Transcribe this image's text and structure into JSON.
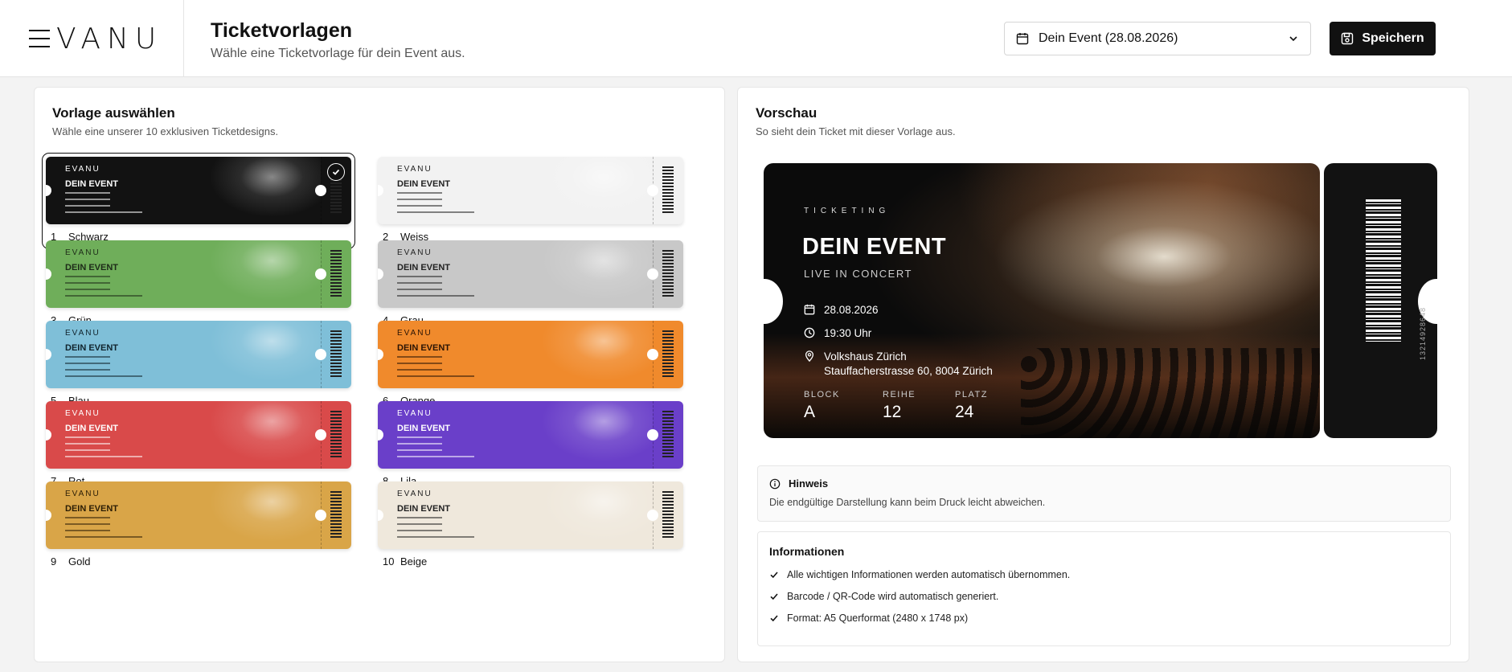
{
  "header": {
    "brand": "VANU",
    "title": "Ticketvorlagen",
    "subtitle": "Wähle eine Ticketvorlage für dein Event aus.",
    "event_select": "Dein Event (28.08.2026)",
    "save_label": "Speichern"
  },
  "templates_panel": {
    "title": "Vorlage auswählen",
    "subtitle": "Wähle eine unserer 10 exklusiven Ticketdesigns.",
    "selected_index": 1,
    "templates": [
      {
        "num": "1",
        "name": "Schwarz",
        "color": "#121212",
        "ink": "#ffffff"
      },
      {
        "num": "2",
        "name": "Weiss",
        "color": "#f2f2f2",
        "ink": "#222222"
      },
      {
        "num": "3",
        "name": "Grün",
        "color": "#6fae5a",
        "ink": "#1d2b18"
      },
      {
        "num": "4",
        "name": "Grau",
        "color": "#c8c8c8",
        "ink": "#222222"
      },
      {
        "num": "5",
        "name": "Blau",
        "color": "#7fbfd8",
        "ink": "#10232c"
      },
      {
        "num": "6",
        "name": "Orange",
        "color": "#f08a2c",
        "ink": "#2a1405"
      },
      {
        "num": "7",
        "name": "Rot",
        "color": "#d94a4a",
        "ink": "#ffffff"
      },
      {
        "num": "8",
        "name": "Lila",
        "color": "#6a3fc9",
        "ink": "#ffffff"
      },
      {
        "num": "9",
        "name": "Gold",
        "color": "#d9a548",
        "ink": "#2b1d05"
      },
      {
        "num": "10",
        "name": "Beige",
        "color": "#efe8dc",
        "ink": "#222222"
      }
    ],
    "mini_brand": "EVANU",
    "mini_event": "DEIN EVENT"
  },
  "preview_panel": {
    "title": "Vorschau",
    "subtitle": "So sieht dein Ticket mit dieser Vorlage aus.",
    "ticket": {
      "brand": "TICKETING",
      "event": "DEIN EVENT",
      "sub": "LIVE IN CONCERT",
      "date": "28.08.2026",
      "time": "19:30 Uhr",
      "venue": "Volkshaus Zürich",
      "address": "Stauffacherstrasse 60, 8004 Zürich",
      "block_label": "BLOCK",
      "block": "A",
      "row_label": "REIHE",
      "row": "12",
      "seat_label": "PLATZ",
      "seat": "24",
      "serial": "13214928648"
    },
    "hint": {
      "title": "Hinweis",
      "text": "Die endgültige Darstellung kann beim Druck leicht abweichen."
    },
    "info": {
      "title": "Informationen",
      "items": [
        "Alle wichtigen Informationen werden automatisch übernommen.",
        "Barcode / QR-Code wird automatisch generiert.",
        "Format: A5 Querformat (2480 x 1748 px)"
      ]
    }
  }
}
